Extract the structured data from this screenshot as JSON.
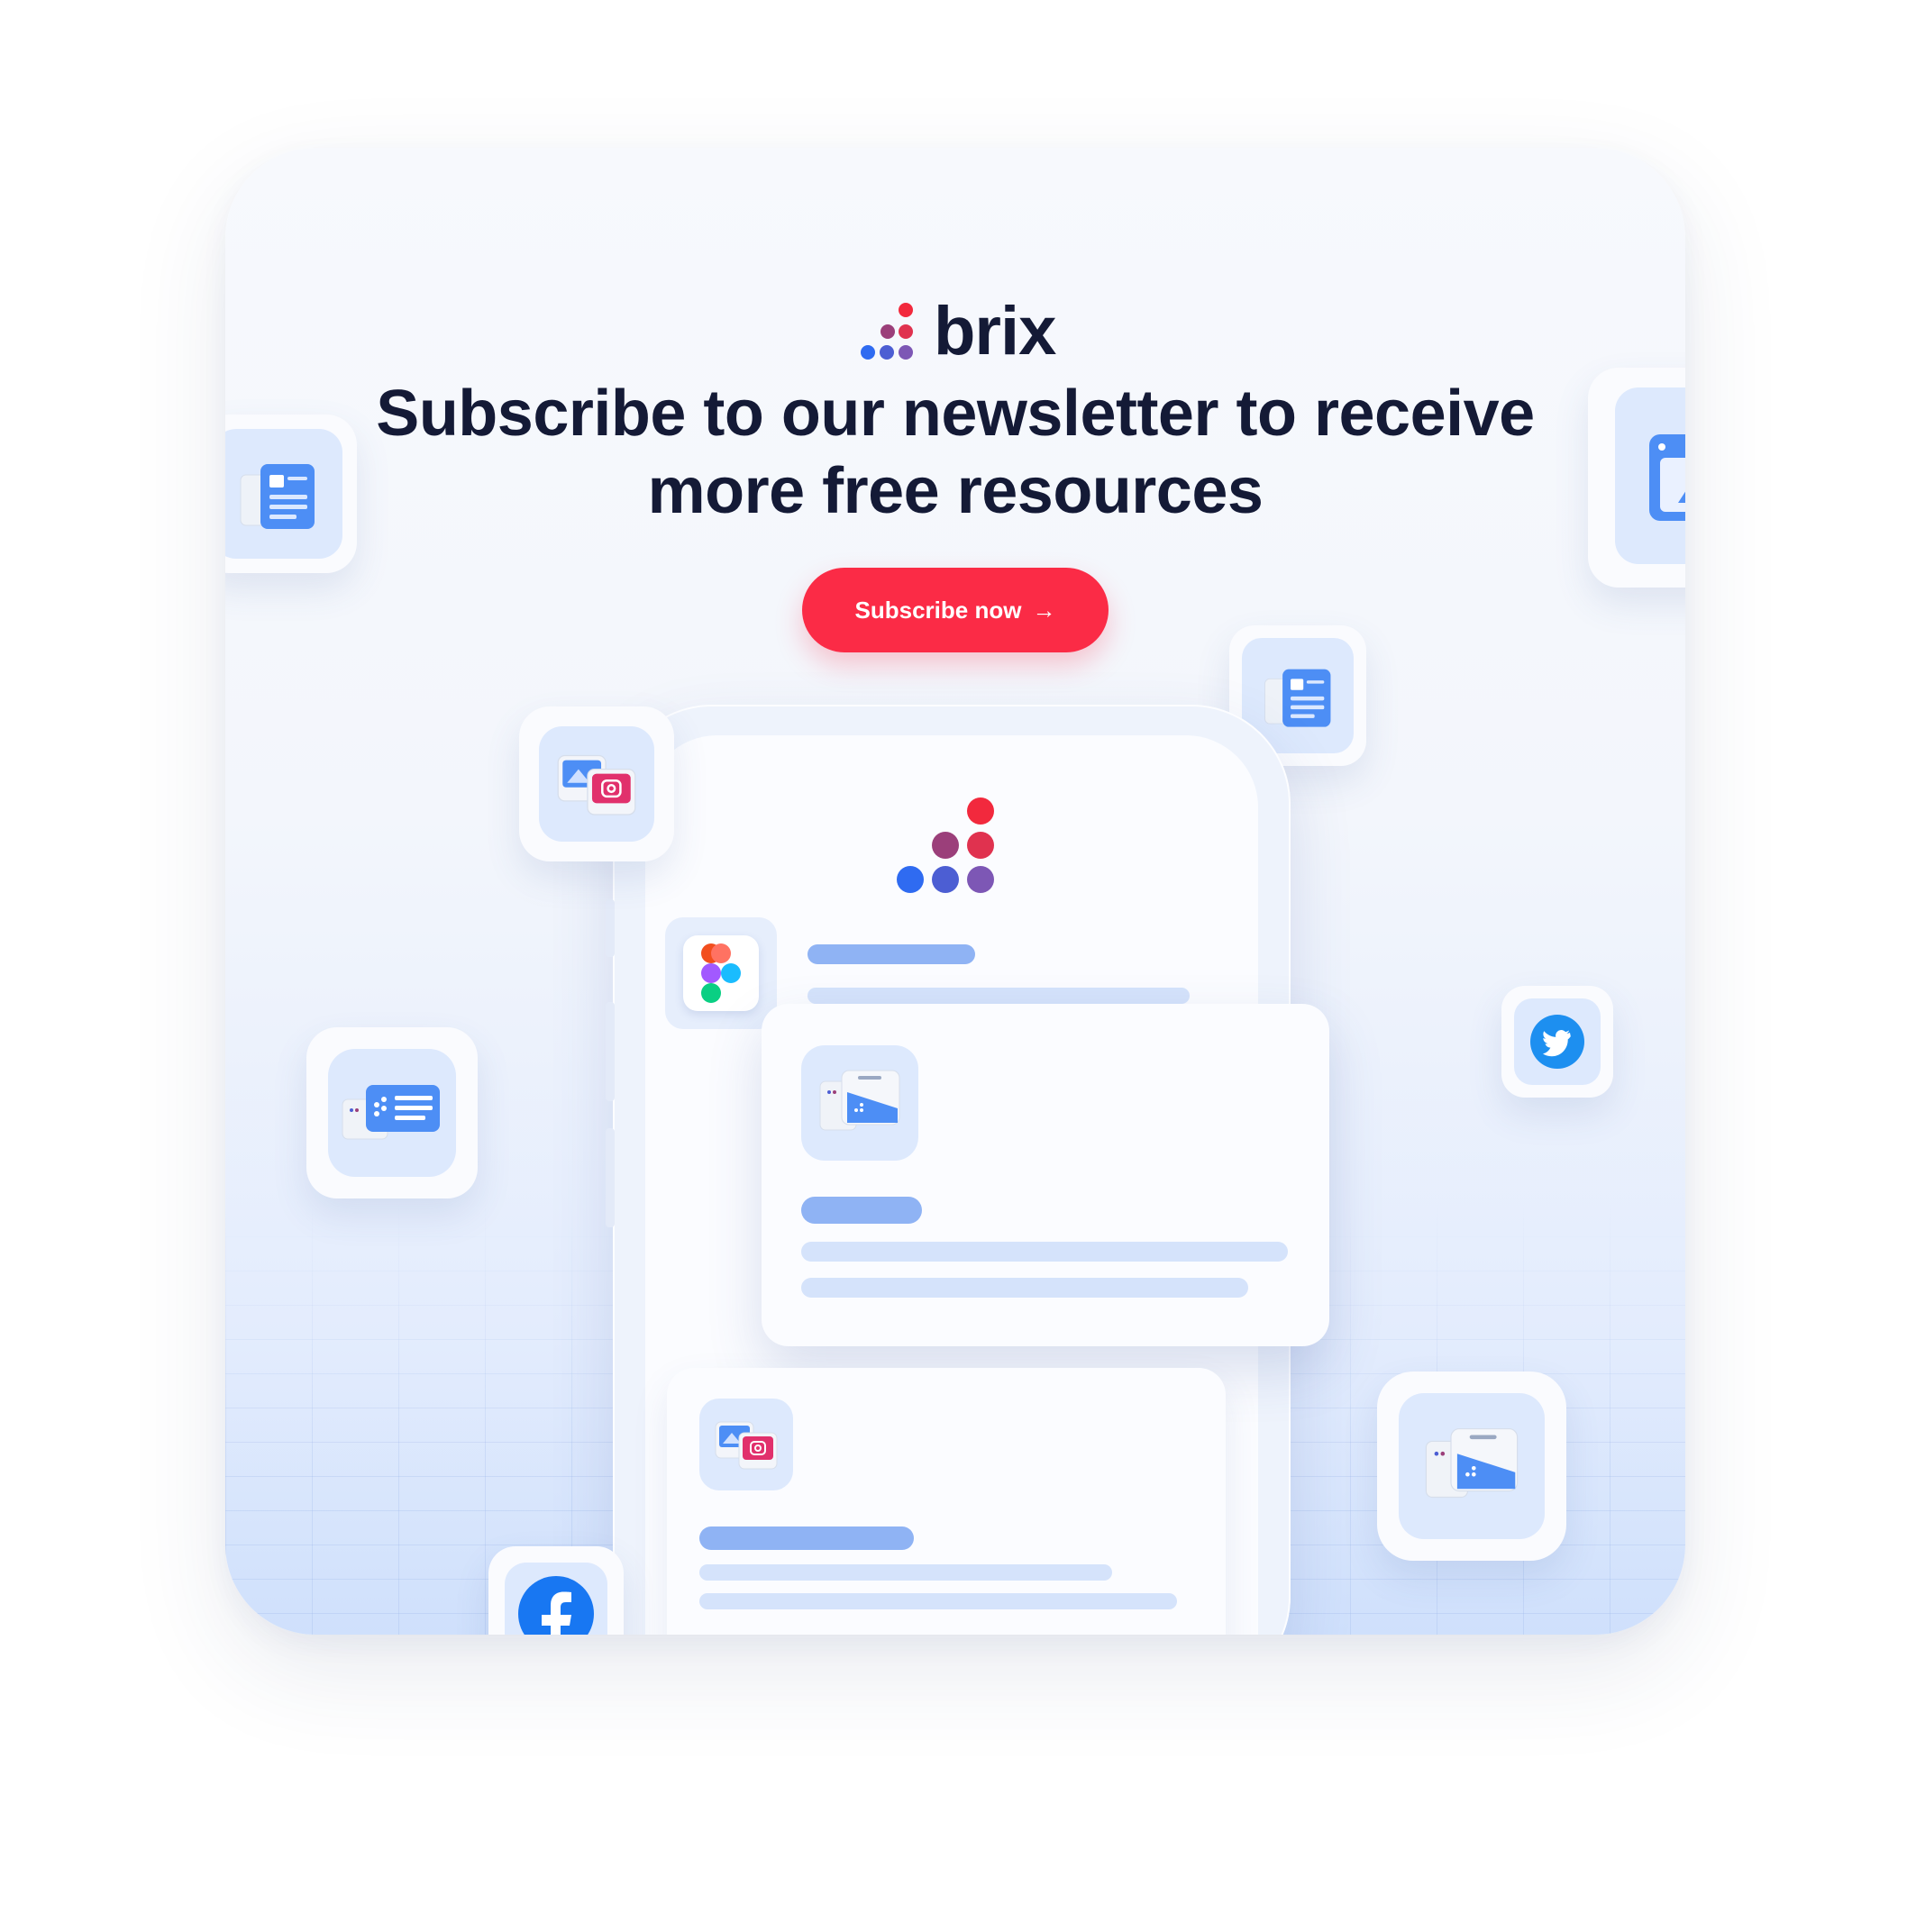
{
  "brand": {
    "name": "brix"
  },
  "headline": "Subscribe to our newsletter to receive more free resources",
  "cta": {
    "label": "Subscribe now",
    "arrow": "→"
  },
  "colors": {
    "accent": "#fb2b46",
    "heading": "#141a36",
    "tile_bg": "#dde9fd",
    "bar_blue": "#8fb3f4",
    "bar_light": "#d5e3fb"
  },
  "icons": [
    "brix-logo-icon",
    "document-icon",
    "image-window-icon",
    "photo-instagram-icon",
    "figma-icon",
    "contact-card-icon",
    "twitter-icon",
    "facebook-icon",
    "template-cards-icon"
  ]
}
